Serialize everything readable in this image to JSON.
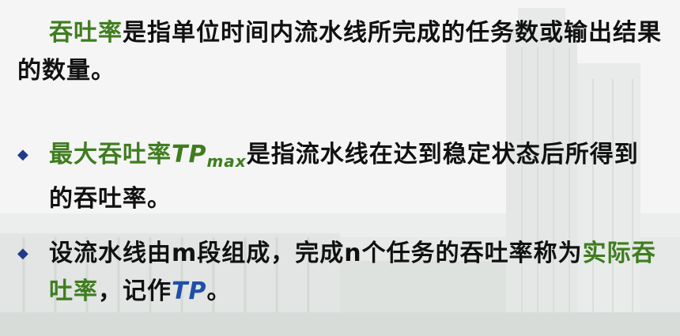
{
  "para1": {
    "term": "吞吐率",
    "rest": "是指单位时间内流水线所完成的任务数或输出结果的数量。"
  },
  "bullet1": {
    "marker": "◆",
    "term": "最大吞吐率",
    "symbol": "TP",
    "subscript": "max",
    "rest": "是指流水线在达到稳定状态后所得到的吞吐率。"
  },
  "bullet2": {
    "marker": "◆",
    "text": "设流水线由m段组成，完成n个任务的吞吐率称为",
    "term": "实际吞吐率",
    "middle": "，记作",
    "symbol": "TP",
    "end": "。"
  },
  "colors": {
    "term_green": "#3f7d1f",
    "symbol_blue": "#1f4fa8",
    "bullet_navy": "#1f3b8a",
    "text": "#111111"
  }
}
